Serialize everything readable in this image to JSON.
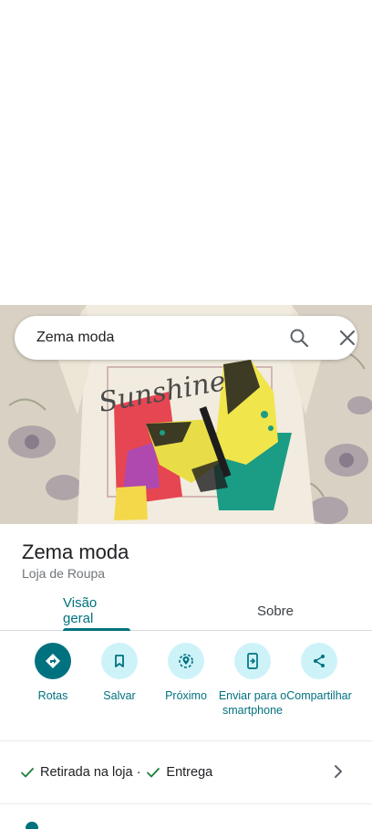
{
  "search": {
    "query": "Zema moda"
  },
  "place": {
    "name": "Zema moda",
    "category": "Loja de Roupa"
  },
  "hero": {
    "shirt_text": "Sunshine"
  },
  "tabs": [
    {
      "label": "Visão geral",
      "active": true
    },
    {
      "label": "Sobre",
      "active": false
    }
  ],
  "actions": [
    {
      "label": "Rotas",
      "icon": "directions-icon"
    },
    {
      "label": "Salvar",
      "icon": "bookmark-icon"
    },
    {
      "label": "Próximo",
      "icon": "nearby-icon"
    },
    {
      "label": "Enviar para o smartphone",
      "icon": "send-to-phone-icon"
    },
    {
      "label": "Compartilhar",
      "icon": "share-icon"
    }
  ],
  "services": {
    "item1": "Retirada na loja",
    "separator": "·",
    "item2": "Entrega"
  },
  "colors": {
    "accent": "#00727f",
    "accent_light": "#cdf3f9",
    "check": "#188038"
  }
}
